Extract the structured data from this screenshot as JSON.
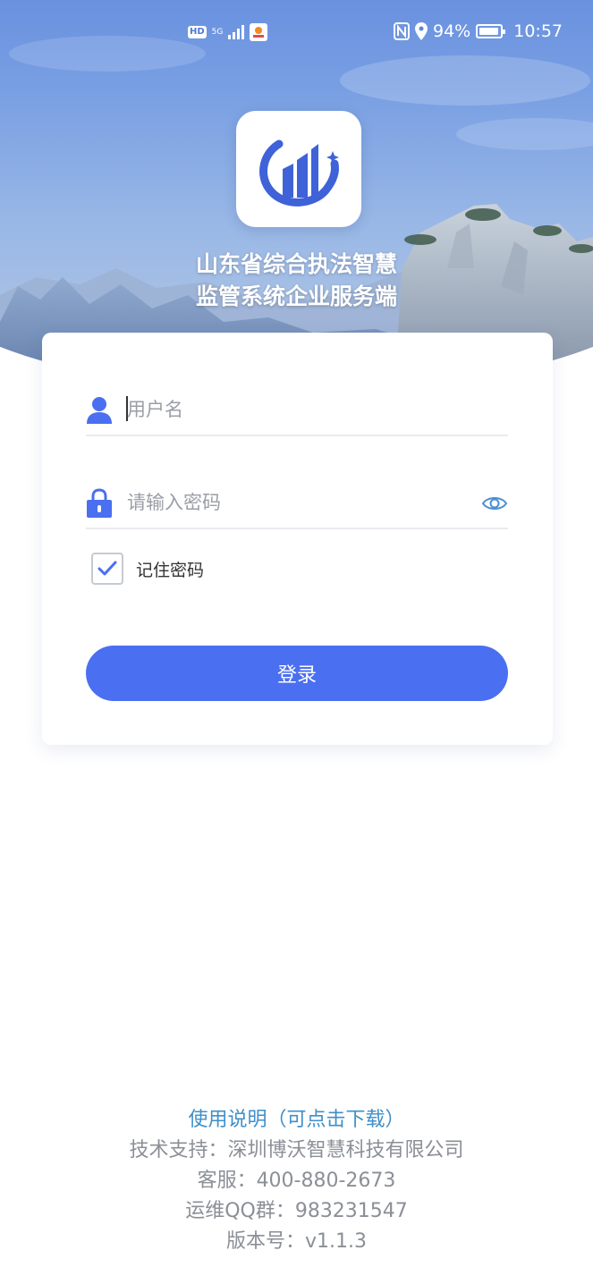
{
  "status_bar": {
    "hd": "HD",
    "network": "5G",
    "battery_percent": "94%",
    "battery_level": 0.94,
    "time": "10:57"
  },
  "app": {
    "title_line1": "山东省综合执法智慧",
    "title_line2": "监管系统企业服务端"
  },
  "login": {
    "username_placeholder": "用户名",
    "password_placeholder": "请输入密码",
    "remember_label": "记住密码",
    "remember_checked": true,
    "submit_label": "登录"
  },
  "footer": {
    "manual_link": "使用说明（可点击下载）",
    "support": "技术支持：深圳博沃智慧科技有限公司",
    "service": "客服：400-880-2673",
    "qq_group": "运维QQ群：983231547",
    "version": "版本号：v1.1.3"
  },
  "colors": {
    "accent": "#4a6ff0",
    "icon_blue": "#4a6ff0",
    "link": "#3f8fc9",
    "footer_text": "#8b8f96"
  }
}
